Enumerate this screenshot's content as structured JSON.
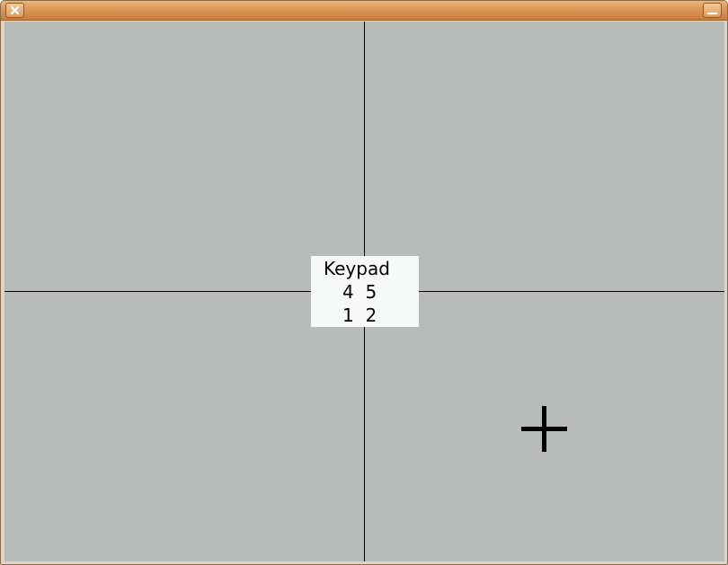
{
  "window": {
    "close_icon": "close-icon",
    "minimize_icon": "minimize-icon",
    "titlebar_color": "#db9556"
  },
  "canvas": {
    "background": "#b8bcb8",
    "crosshair_color": "#000000"
  },
  "keypad": {
    "title": "Keypad",
    "row1": "4  5",
    "row2": "1  2"
  },
  "cursor": {
    "icon": "crosshair-cursor-icon"
  }
}
